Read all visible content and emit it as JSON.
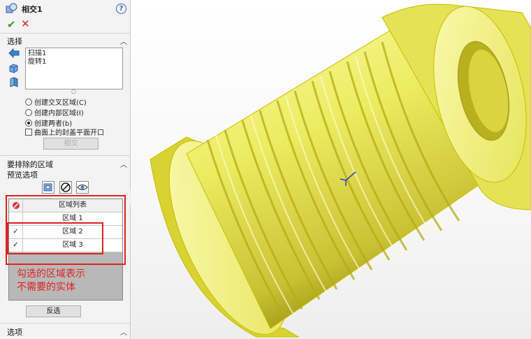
{
  "feature": {
    "title": "相交1",
    "help_icon": "?"
  },
  "confirm": {
    "ok_icon": "✔",
    "cancel_icon": "✕"
  },
  "selection": {
    "header": "选择",
    "items": [
      "扫描1",
      "旋转1"
    ],
    "options": [
      {
        "label": "创建交叉区域(C)",
        "checked": false
      },
      {
        "label": "创建内部区域(I)",
        "checked": false
      },
      {
        "label": "创建两者(b)",
        "checked": true
      }
    ],
    "checkbox_label": "曲面上的封盖平面开口",
    "checkbox_checked": false,
    "intersect_button": "相交"
  },
  "exclude": {
    "header": "要排除的区域",
    "preview_label": "预览选项",
    "table": {
      "column": "区域列表",
      "rows": [
        {
          "label": "区域  1",
          "checked": false
        },
        {
          "label": "区域  2",
          "checked": true
        },
        {
          "label": "区域  3",
          "checked": true
        }
      ]
    },
    "invert_button": "反选"
  },
  "annotation": {
    "line1": "勾选的区域表示",
    "line2": "不需要的实体",
    "color": "#e0211f"
  },
  "options_header": "选项",
  "colors": {
    "model": "#f0ef6a",
    "edge": "#d6cf00",
    "panel": "#f3f3f3"
  }
}
